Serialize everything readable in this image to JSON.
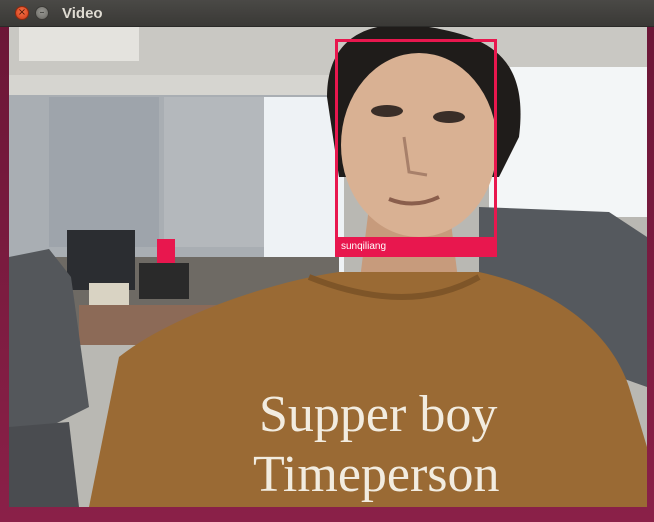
{
  "window": {
    "title": "Video",
    "close_glyph": "×",
    "minimize_glyph": "–"
  },
  "detection": {
    "label": "sunqiliang",
    "box_color": "#e8174e"
  },
  "scene": {
    "shirt_line1": "Supper boy",
    "shirt_line2": "Timeperson"
  },
  "icons": {
    "close": "close-icon",
    "minimize": "minimize-icon"
  }
}
